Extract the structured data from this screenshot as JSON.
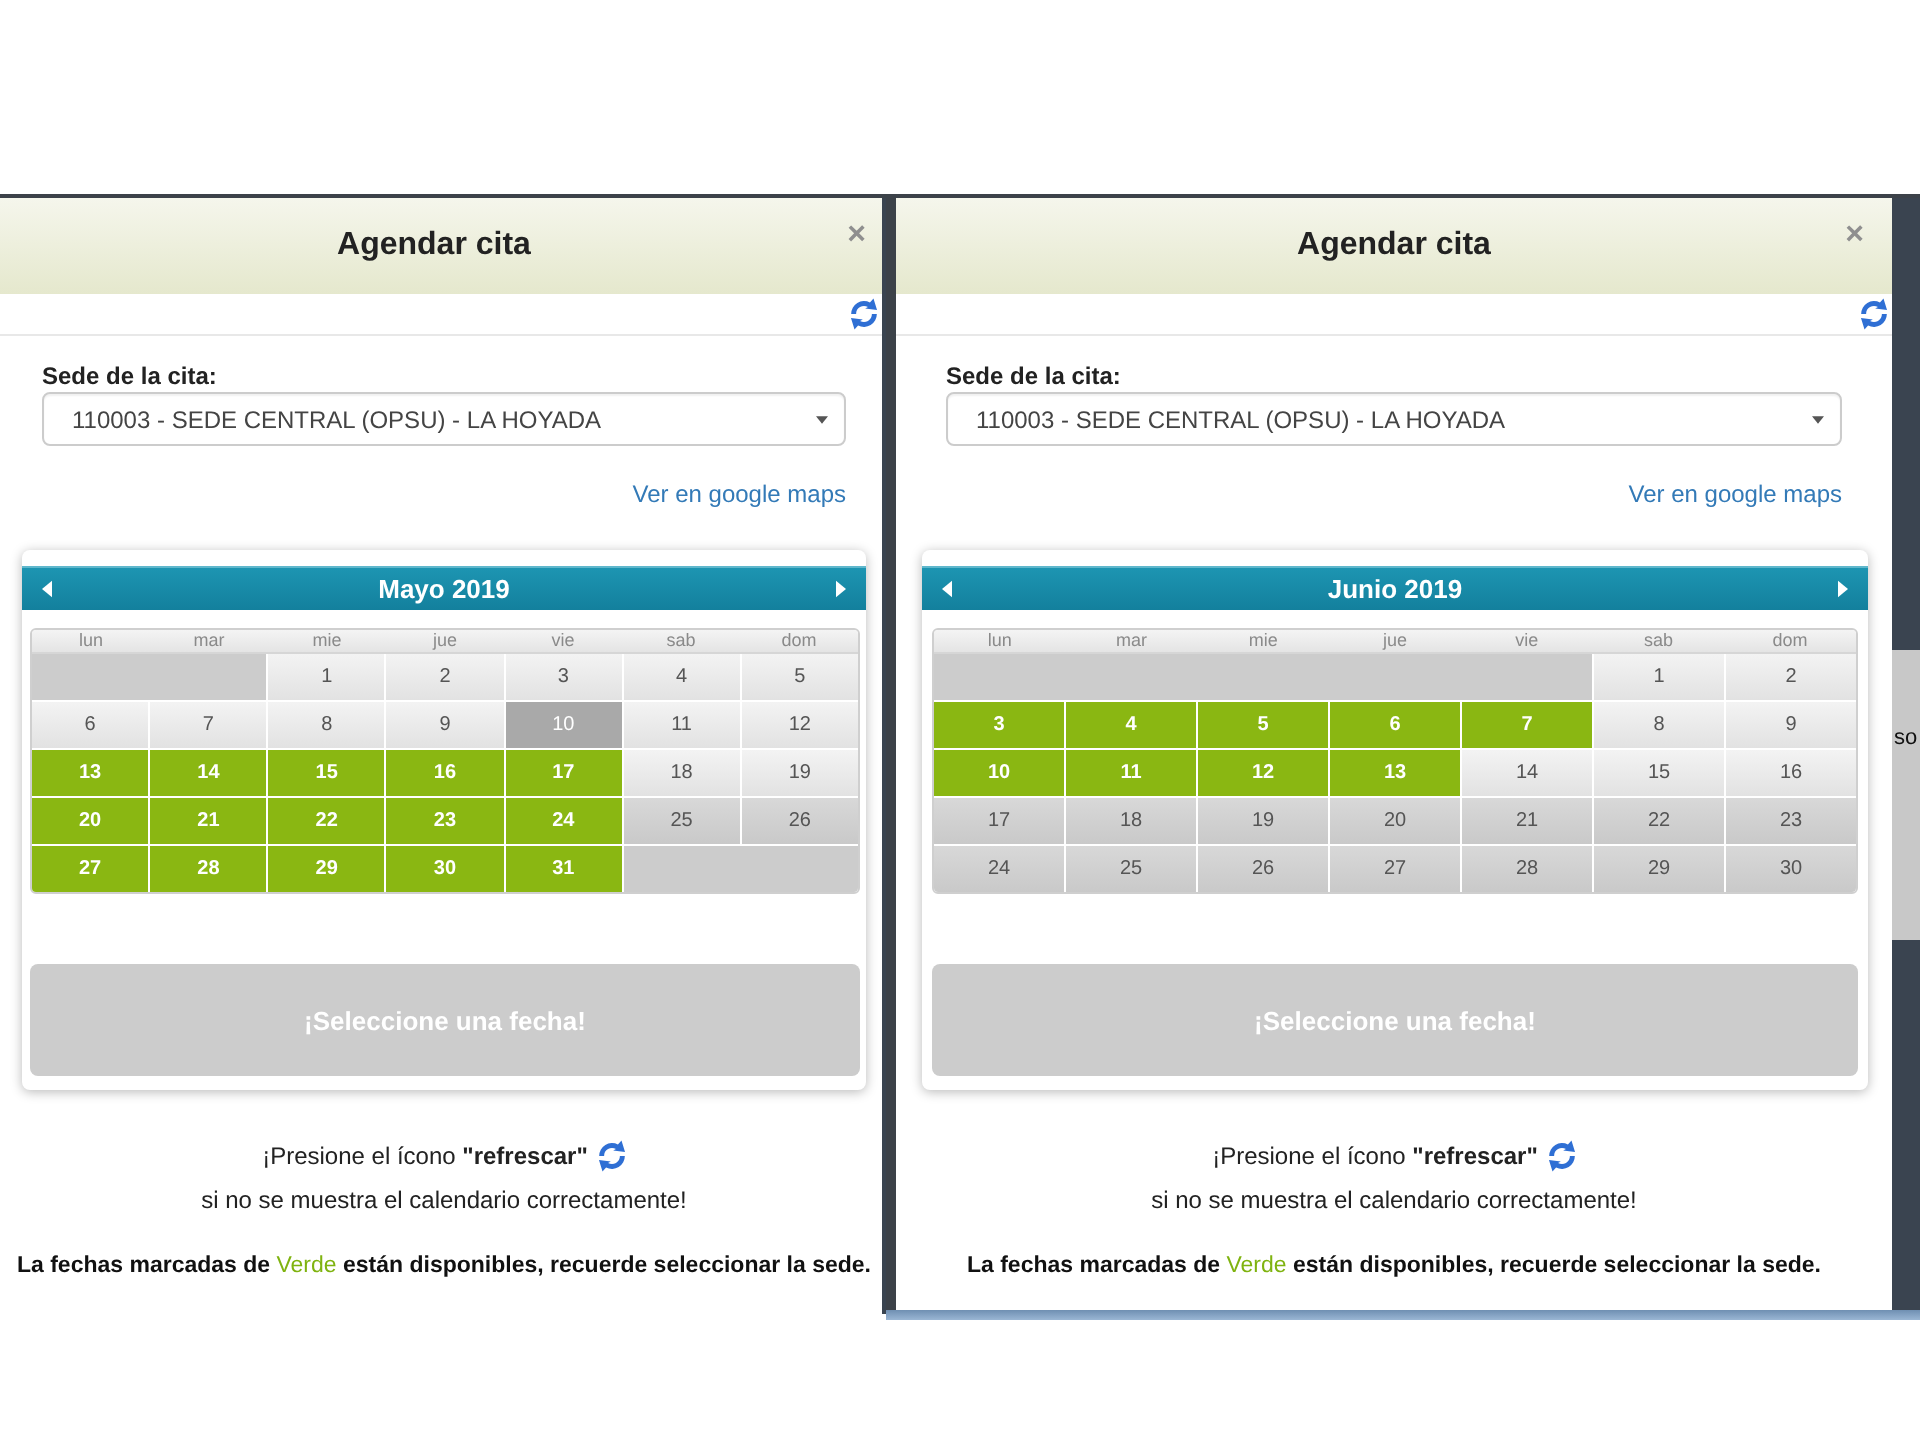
{
  "screens": [
    {
      "dialog": {
        "title": "Agendar cita",
        "close_symbol": "×"
      },
      "site_field": {
        "label": "Sede de la cita:",
        "value": "110003 - SEDE CENTRAL (OPSU) - LA HOYADA"
      },
      "map_link": "Ver en google maps",
      "calendar": {
        "month_title": "Mayo 2019",
        "weekdays": [
          "lun",
          "mar",
          "mie",
          "jue",
          "vie",
          "sab",
          "dom"
        ],
        "weeks": [
          [
            {
              "kind": "empty"
            },
            {
              "kind": "empty"
            },
            {
              "day": "1",
              "kind": "plain"
            },
            {
              "day": "2",
              "kind": "plain"
            },
            {
              "day": "3",
              "kind": "plain"
            },
            {
              "day": "4",
              "kind": "plain"
            },
            {
              "day": "5",
              "kind": "plain"
            }
          ],
          [
            {
              "day": "6",
              "kind": "plain"
            },
            {
              "day": "7",
              "kind": "plain"
            },
            {
              "day": "8",
              "kind": "plain"
            },
            {
              "day": "9",
              "kind": "plain"
            },
            {
              "day": "10",
              "kind": "highlighted"
            },
            {
              "day": "11",
              "kind": "plain"
            },
            {
              "day": "12",
              "kind": "plain"
            }
          ],
          [
            {
              "day": "13",
              "kind": "available"
            },
            {
              "day": "14",
              "kind": "available"
            },
            {
              "day": "15",
              "kind": "available"
            },
            {
              "day": "16",
              "kind": "available"
            },
            {
              "day": "17",
              "kind": "available"
            },
            {
              "day": "18",
              "kind": "plain"
            },
            {
              "day": "19",
              "kind": "plain"
            }
          ],
          [
            {
              "day": "20",
              "kind": "available"
            },
            {
              "day": "21",
              "kind": "available"
            },
            {
              "day": "22",
              "kind": "available"
            },
            {
              "day": "23",
              "kind": "available"
            },
            {
              "day": "24",
              "kind": "available"
            },
            {
              "day": "25",
              "kind": "unavailable"
            },
            {
              "day": "26",
              "kind": "unavailable"
            }
          ],
          [
            {
              "day": "27",
              "kind": "available"
            },
            {
              "day": "28",
              "kind": "available"
            },
            {
              "day": "29",
              "kind": "available"
            },
            {
              "day": "30",
              "kind": "available"
            },
            {
              "day": "31",
              "kind": "available"
            },
            {
              "kind": "empty"
            },
            {
              "kind": "empty"
            }
          ]
        ],
        "action_button": {
          "label": "¡Seleccione una fecha!",
          "disabled": true
        }
      },
      "hint_lines": [
        "¡Presione el ícono **\"refrescar\"**",
        "si no se muestra el calendario correctamente!"
      ],
      "legend": {
        "text_before": "La fechas marcadas de ",
        "highlight": "Verde",
        "text_after": " están disponibles, recuerde seleccionar la sede."
      }
    },
    {
      "dialog": {
        "title": "Agendar cita",
        "close_symbol": "×"
      },
      "site_field": {
        "label": "Sede de la cita:",
        "value": "110003 - SEDE CENTRAL (OPSU) - LA HOYADA"
      },
      "map_link": "Ver en google maps",
      "calendar": {
        "month_title": "Junio 2019",
        "weekdays": [
          "lun",
          "mar",
          "mie",
          "jue",
          "vie",
          "sab",
          "dom"
        ],
        "weeks": [
          [
            {
              "kind": "empty"
            },
            {
              "kind": "empty"
            },
            {
              "kind": "empty"
            },
            {
              "kind": "empty"
            },
            {
              "kind": "empty"
            },
            {
              "day": "1",
              "kind": "plain"
            },
            {
              "day": "2",
              "kind": "plain"
            }
          ],
          [
            {
              "day": "3",
              "kind": "available"
            },
            {
              "day": "4",
              "kind": "available"
            },
            {
              "day": "5",
              "kind": "available"
            },
            {
              "day": "6",
              "kind": "available"
            },
            {
              "day": "7",
              "kind": "available"
            },
            {
              "day": "8",
              "kind": "plain"
            },
            {
              "day": "9",
              "kind": "plain"
            }
          ],
          [
            {
              "day": "10",
              "kind": "available"
            },
            {
              "day": "11",
              "kind": "available"
            },
            {
              "day": "12",
              "kind": "available"
            },
            {
              "day": "13",
              "kind": "available"
            },
            {
              "day": "14",
              "kind": "plain"
            },
            {
              "day": "15",
              "kind": "plain"
            },
            {
              "day": "16",
              "kind": "plain"
            }
          ],
          [
            {
              "day": "17",
              "kind": "unavailable"
            },
            {
              "day": "18",
              "kind": "unavailable"
            },
            {
              "day": "19",
              "kind": "unavailable"
            },
            {
              "day": "20",
              "kind": "unavailable"
            },
            {
              "day": "21",
              "kind": "unavailable"
            },
            {
              "day": "22",
              "kind": "unavailable"
            },
            {
              "day": "23",
              "kind": "unavailable"
            }
          ],
          [
            {
              "day": "24",
              "kind": "unavailable"
            },
            {
              "day": "25",
              "kind": "unavailable"
            },
            {
              "day": "26",
              "kind": "unavailable"
            },
            {
              "day": "27",
              "kind": "unavailable"
            },
            {
              "day": "28",
              "kind": "unavailable"
            },
            {
              "day": "29",
              "kind": "unavailable"
            },
            {
              "day": "30",
              "kind": "unavailable"
            }
          ]
        ],
        "action_button": {
          "label": "¡Seleccione una fecha!",
          "disabled": true
        }
      },
      "hint_lines": [
        "¡Presione el ícono **\"refrescar\"**",
        "si no se muestra el calendario correctamente!"
      ],
      "legend": {
        "text_before": "La fechas marcadas de ",
        "highlight": "Verde",
        "text_after": " están disponibles, recuerde seleccionar la sede."
      },
      "backdrop_text": "so",
      "taskbar": true
    }
  ]
}
